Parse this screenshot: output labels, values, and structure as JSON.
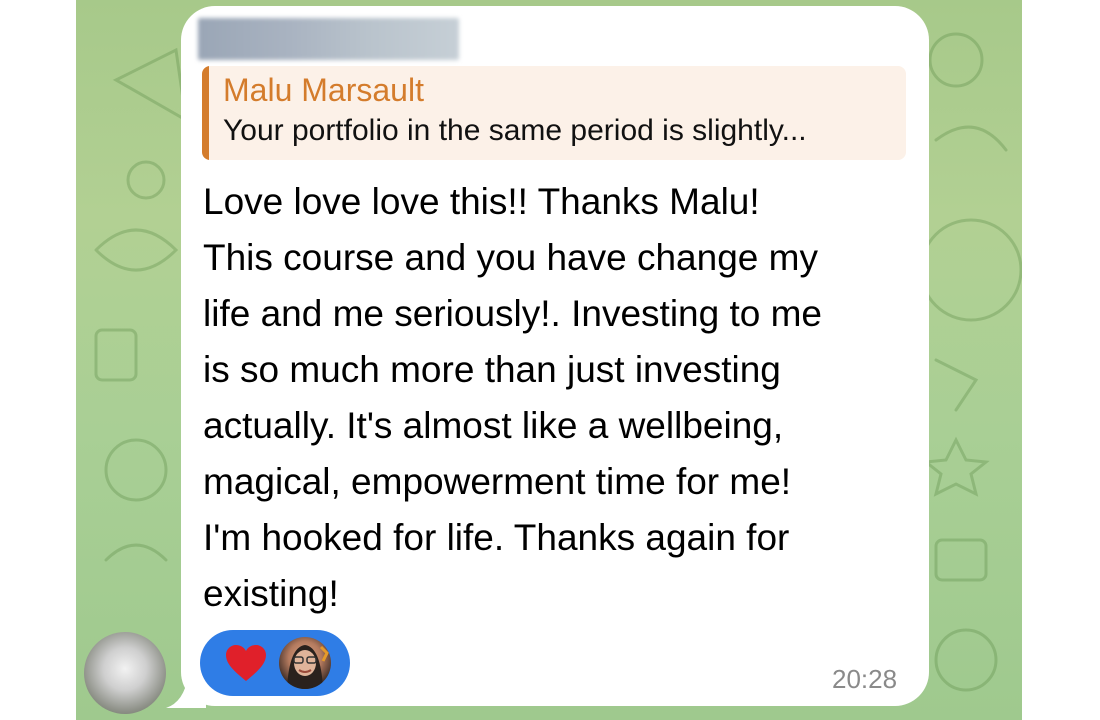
{
  "chat": {
    "reply": {
      "author": "Malu Marsault",
      "snippet": "Your portfolio in the same period is slightly..."
    },
    "message_lines": [
      "Love love love this!! Thanks Malu!",
      "This course and you have change my",
      "life and me seriously!. Investing to me",
      "is so much more than just investing",
      "actually. It's almost like a wellbeing,",
      "magical, empowerment time for me!",
      "I'm hooked for life. Thanks again for",
      "existing!"
    ],
    "time": "20:28",
    "reactions": [
      {
        "icon": "heart-icon",
        "color": "#e0202a"
      }
    ]
  },
  "colors": {
    "reply_accent": "#d47c2c",
    "reaction_pill": "#2f7de6",
    "chat_background": "#a9cf95"
  }
}
